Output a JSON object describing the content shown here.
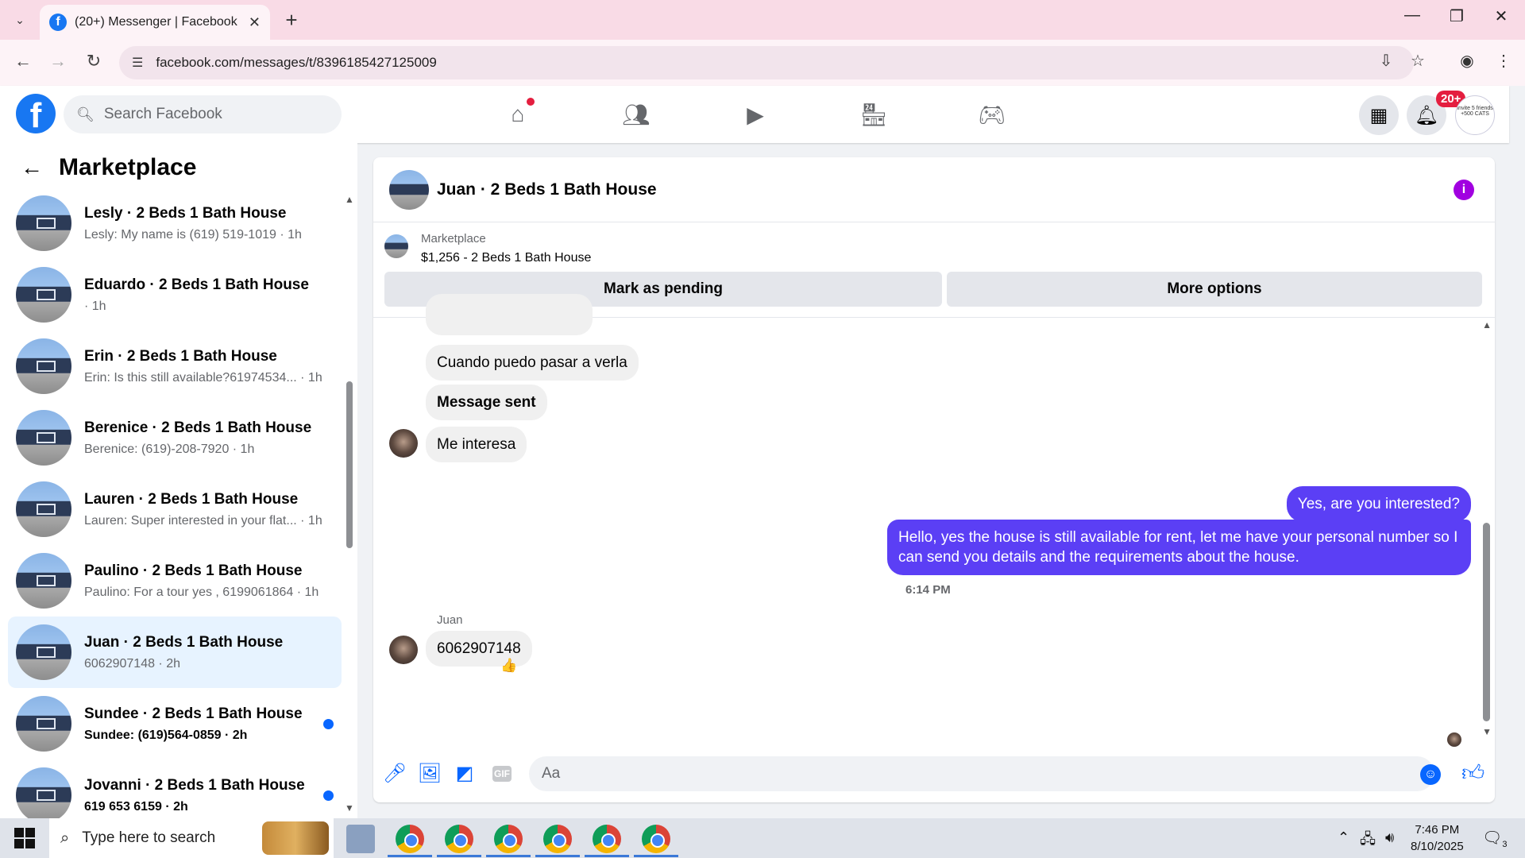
{
  "browser": {
    "tab_title": "(20+) Messenger | Facebook",
    "url": "facebook.com/messages/t/8396185427125009"
  },
  "fb": {
    "search_placeholder": "Search Facebook",
    "notification_badge": "20+",
    "profile_text": "Invite 5 friends +500 CATS"
  },
  "sidebar": {
    "title": "Marketplace",
    "conversations": [
      {
        "name": "Lesly · 2 Beds 1 Bath House",
        "preview": "Lesly: My name is (619) 519-1019 · 1h",
        "unread": false,
        "active": false
      },
      {
        "name": "Eduardo · 2 Beds 1 Bath House",
        "preview": "· 1h",
        "unread": false,
        "active": false
      },
      {
        "name": "Erin · 2 Beds 1 Bath House",
        "preview": "Erin: Is this still available?61974534... · 1h",
        "unread": false,
        "active": false
      },
      {
        "name": "Berenice · 2 Beds 1 Bath House",
        "preview": "Berenice: (619)-208-7920 · 1h",
        "unread": false,
        "active": false
      },
      {
        "name": "Lauren · 2 Beds 1 Bath House",
        "preview": "Lauren: Super interested in your flat... · 1h",
        "unread": false,
        "active": false
      },
      {
        "name": "Paulino · 2 Beds 1 Bath House",
        "preview": "Paulino: For a tour yes , 6199061864 · 1h",
        "unread": false,
        "active": false
      },
      {
        "name": "Juan · 2 Beds 1 Bath House",
        "preview": "6062907148 · 2h",
        "unread": false,
        "active": true
      },
      {
        "name": "Sundee · 2 Beds 1 Bath House",
        "preview": "Sundee: (619)564-0859 · 2h",
        "unread": true,
        "active": false
      },
      {
        "name": "Jovanni · 2 Beds 1 Bath House",
        "preview": "619 653 6159 · 2h",
        "unread": true,
        "active": false
      }
    ]
  },
  "chat": {
    "title": "Juan · 2 Beds 1 Bath House",
    "listing_source": "Marketplace",
    "listing_price": "$1,256 - 2 Beds 1 Bath House",
    "mark_pending": "Mark as pending",
    "more_options": "More options",
    "messages": {
      "m1": "Cuando puedo pasar a verla",
      "m2": "Message sent",
      "m3": "Me interesa",
      "o1": "Yes, are you interested?",
      "o2": "Hello, yes the house is still available for rent, let me have your personal number so I can send you details and the requirements about the house.",
      "timestamp": "6:14 PM",
      "sender": "Juan",
      "m4": "6062907148"
    },
    "composer_placeholder": "Aa"
  },
  "taskbar": {
    "search_placeholder": "Type here to search",
    "time": "7:46 PM",
    "date": "8/10/2025",
    "notif_count": "3"
  }
}
